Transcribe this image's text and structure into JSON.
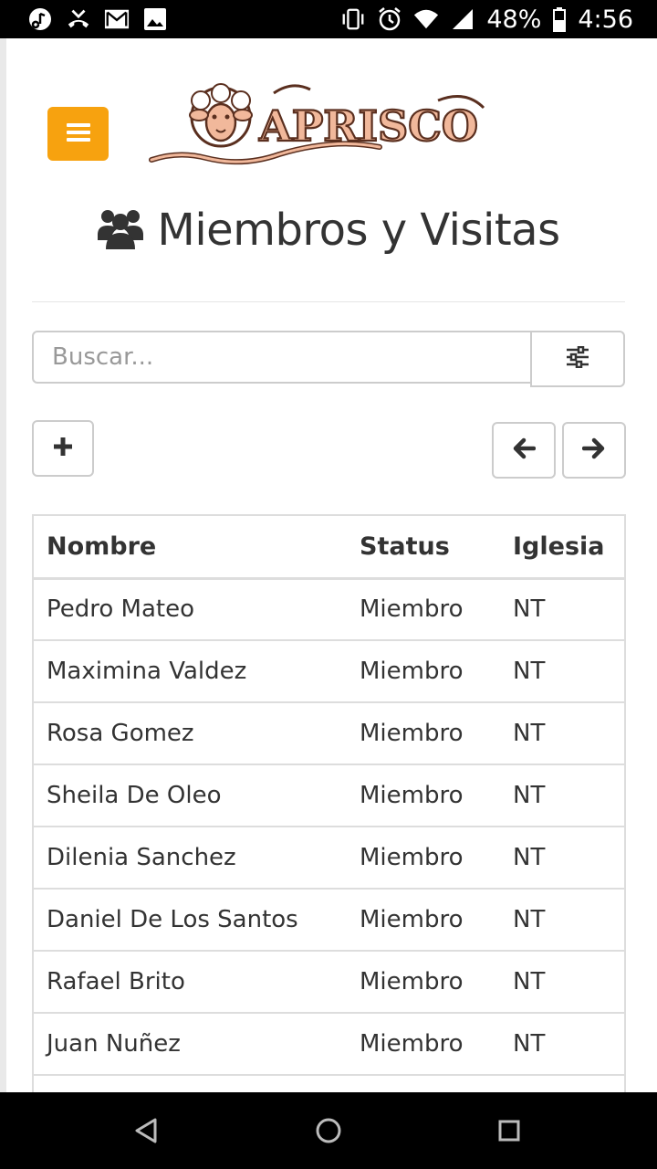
{
  "status_bar": {
    "battery": "48%",
    "time": "4:56",
    "left_icons": [
      "music-note-icon",
      "missed-call-icon",
      "gmail-icon",
      "image-icon"
    ],
    "right_icons": [
      "vibrate-icon",
      "alarm-icon",
      "wifi-icon",
      "signal-icon",
      "battery-icon"
    ]
  },
  "header": {
    "menu_icon": "hamburger-icon",
    "logo_text": "APRISCO"
  },
  "page": {
    "title_icon": "users-icon",
    "title": "Miembros y Visitas"
  },
  "search": {
    "placeholder": "Buscar...",
    "value": "",
    "filter_icon": "sliders-icon"
  },
  "toolbar": {
    "add_icon": "plus-icon",
    "prev_icon": "arrow-left-icon",
    "next_icon": "arrow-right-icon"
  },
  "table": {
    "headers": [
      "Nombre",
      "Status",
      "Iglesia"
    ],
    "rows": [
      [
        "Pedro Mateo",
        "Miembro",
        "NT"
      ],
      [
        "Maximina Valdez",
        "Miembro",
        "NT"
      ],
      [
        "Rosa Gomez",
        "Miembro",
        "NT"
      ],
      [
        "Sheila De Oleo",
        "Miembro",
        "NT"
      ],
      [
        "Dilenia Sanchez",
        "Miembro",
        "NT"
      ],
      [
        "Daniel De Los Santos",
        "Miembro",
        "NT"
      ],
      [
        "Rafael Brito",
        "Miembro",
        "NT"
      ],
      [
        "Juan Nuñez",
        "Miembro",
        "NT"
      ]
    ]
  },
  "colors": {
    "accent": "#f7a20f",
    "logo_brown": "#5a2f1f",
    "logo_peach": "#f1b89b"
  },
  "nav_bar": {
    "icons": [
      "back-icon",
      "home-icon",
      "recents-icon"
    ]
  }
}
